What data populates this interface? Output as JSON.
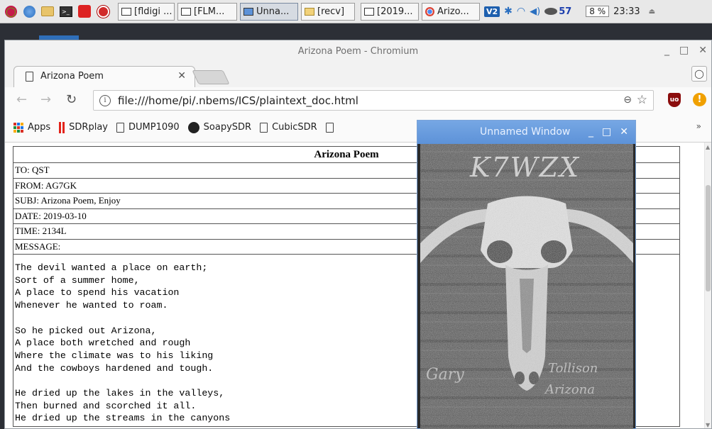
{
  "taskbar": {
    "tasks": [
      {
        "label": "[fldigi ..."
      },
      {
        "label": "[FLM..."
      },
      {
        "label": "Unna..."
      },
      {
        "label": "[recv]"
      },
      {
        "label": "[2019..."
      },
      {
        "label": "Arizo..."
      }
    ],
    "tray": {
      "vnc_label": "V2",
      "network_count": "57",
      "cpu_label": "8 %",
      "clock": "23:33"
    }
  },
  "browser": {
    "window_title": "Arizona Poem - Chromium",
    "tab_title": "Arizona Poem",
    "url": "file:///home/pi/.nbems/ICS/plaintext_doc.html",
    "bookmarks": [
      {
        "label": "Apps",
        "icon": "apps-grid-icon"
      },
      {
        "label": "SDRplay",
        "icon": "sdrplay-icon"
      },
      {
        "label": "DUMP1090",
        "icon": "page-icon"
      },
      {
        "label": "SoapySDR",
        "icon": "github-icon"
      },
      {
        "label": "CubicSDR",
        "icon": "page-icon"
      }
    ],
    "more_bookmarks": "»"
  },
  "document": {
    "title": "Arizona Poem",
    "fields": {
      "to": "TO: QST",
      "from": "FROM: AG7GK",
      "subj": "SUBJ: Arizona Poem, Enjoy",
      "date": "DATE: 2019-03-10",
      "time": "TIME: 2134L",
      "message_label": "MESSAGE:"
    },
    "message_lines": [
      "The devil wanted a place on earth;",
      "Sort of a summer home,",
      "A place to spend his vacation",
      "Whenever he wanted to roam.",
      "",
      "So he picked out Arizona,",
      "A place both wretched and rough",
      "Where the climate was to his liking",
      "And the cowboys hardened and tough.",
      "",
      "He dried up the lakes in the valleys,",
      "Then burned and scorched it all.",
      "He dried up the streams in the canyons"
    ]
  },
  "float_window": {
    "title": "Unnamed Window",
    "image_text": {
      "callsign": "K7WZX",
      "left_word": "Gary",
      "right_word_1": "Tollison",
      "right_word_2": "Arizona"
    }
  },
  "colors": {
    "float_title_bar": "#5d92d8",
    "ublock_shield": "#8b0d0d",
    "warning_badge": "#f0a000",
    "sdrplay_bars": "#e2231a"
  }
}
